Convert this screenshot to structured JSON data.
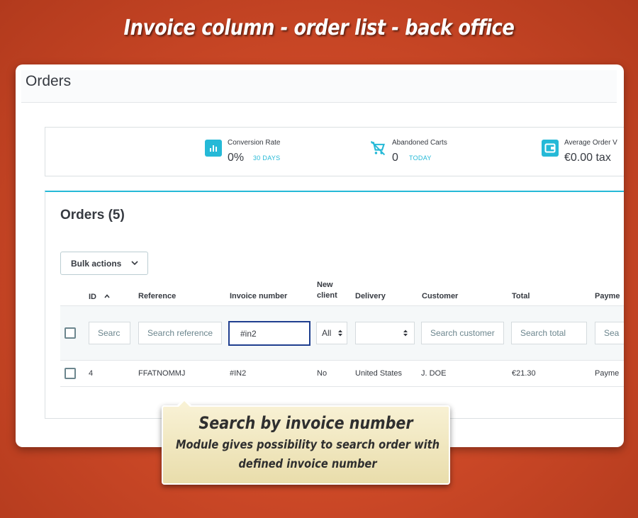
{
  "banner": {
    "title": "Invoice column - order list - back office"
  },
  "page": {
    "title": "Orders"
  },
  "kpis": [
    {
      "icon": "bar-chart-icon",
      "label": "Conversion Rate",
      "value": "0%",
      "period": "30 DAYS"
    },
    {
      "icon": "cart-icon",
      "label": "Abandoned Carts",
      "value": "0",
      "period": "TODAY"
    },
    {
      "icon": "wallet-icon",
      "label": "Average Order V",
      "value": "€0.00 tax",
      "period": ""
    }
  ],
  "orders": {
    "title": "Orders (5)",
    "bulk_actions_label": "Bulk actions",
    "columns": {
      "id": "ID",
      "reference": "Reference",
      "invoice_number": "Invoice number",
      "new_client": "New client",
      "delivery": "Delivery",
      "customer": "Customer",
      "total": "Total",
      "payment": "Payme"
    },
    "filters": {
      "id_placeholder": "Searc",
      "reference_placeholder": "Search reference",
      "invoice_value": "#in2",
      "new_client_value": "All",
      "delivery_value": "",
      "customer_placeholder": "Search customer",
      "total_placeholder": "Search total",
      "payment_placeholder": "Sea"
    },
    "rows": [
      {
        "id": "4",
        "reference": "FFATNOMMJ",
        "invoice_number": "#IN2",
        "new_client": "No",
        "delivery": "United States",
        "customer": "J. DOE",
        "total": "€21.30",
        "payment": "Payme"
      }
    ]
  },
  "callout": {
    "title": "Search by invoice number",
    "description": "Module gives possibility to search order with defined invoice number"
  },
  "colors": {
    "accent": "#25b9d7",
    "background": "#cf4a28",
    "focus_border": "#1f3f8f",
    "callout": "#f3e9c0"
  }
}
